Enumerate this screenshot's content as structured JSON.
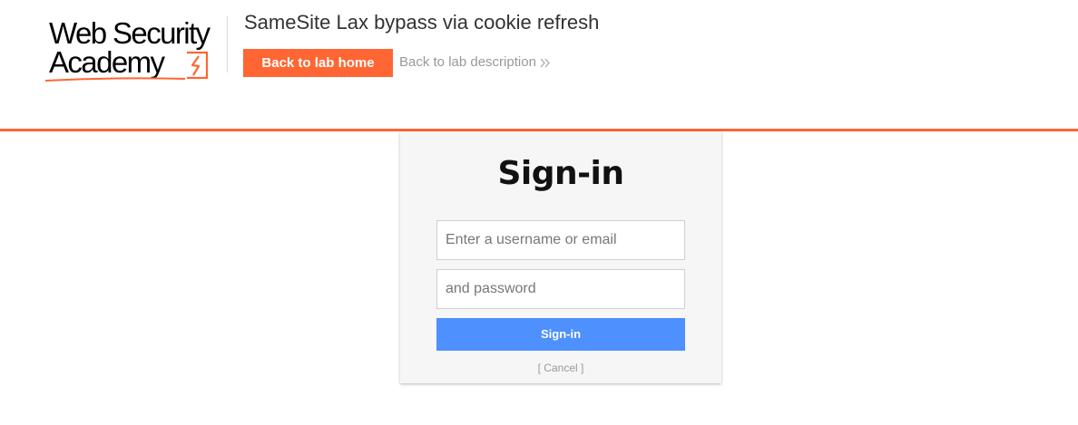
{
  "header": {
    "logo": {
      "line1": "Web Security",
      "line2": "Academy"
    },
    "lab_title": "SameSite Lax bypass via cookie refresh",
    "back_home_label": "Back to lab home",
    "back_description_label": "Back to lab description"
  },
  "login": {
    "title": "Sign-in",
    "username_placeholder": "Enter a username or email",
    "password_placeholder": "and password",
    "submit_label": "Sign-in",
    "cancel_label": "[ Cancel ]"
  },
  "colors": {
    "brand_orange": "#ff6633",
    "button_blue": "#4d90fe"
  }
}
